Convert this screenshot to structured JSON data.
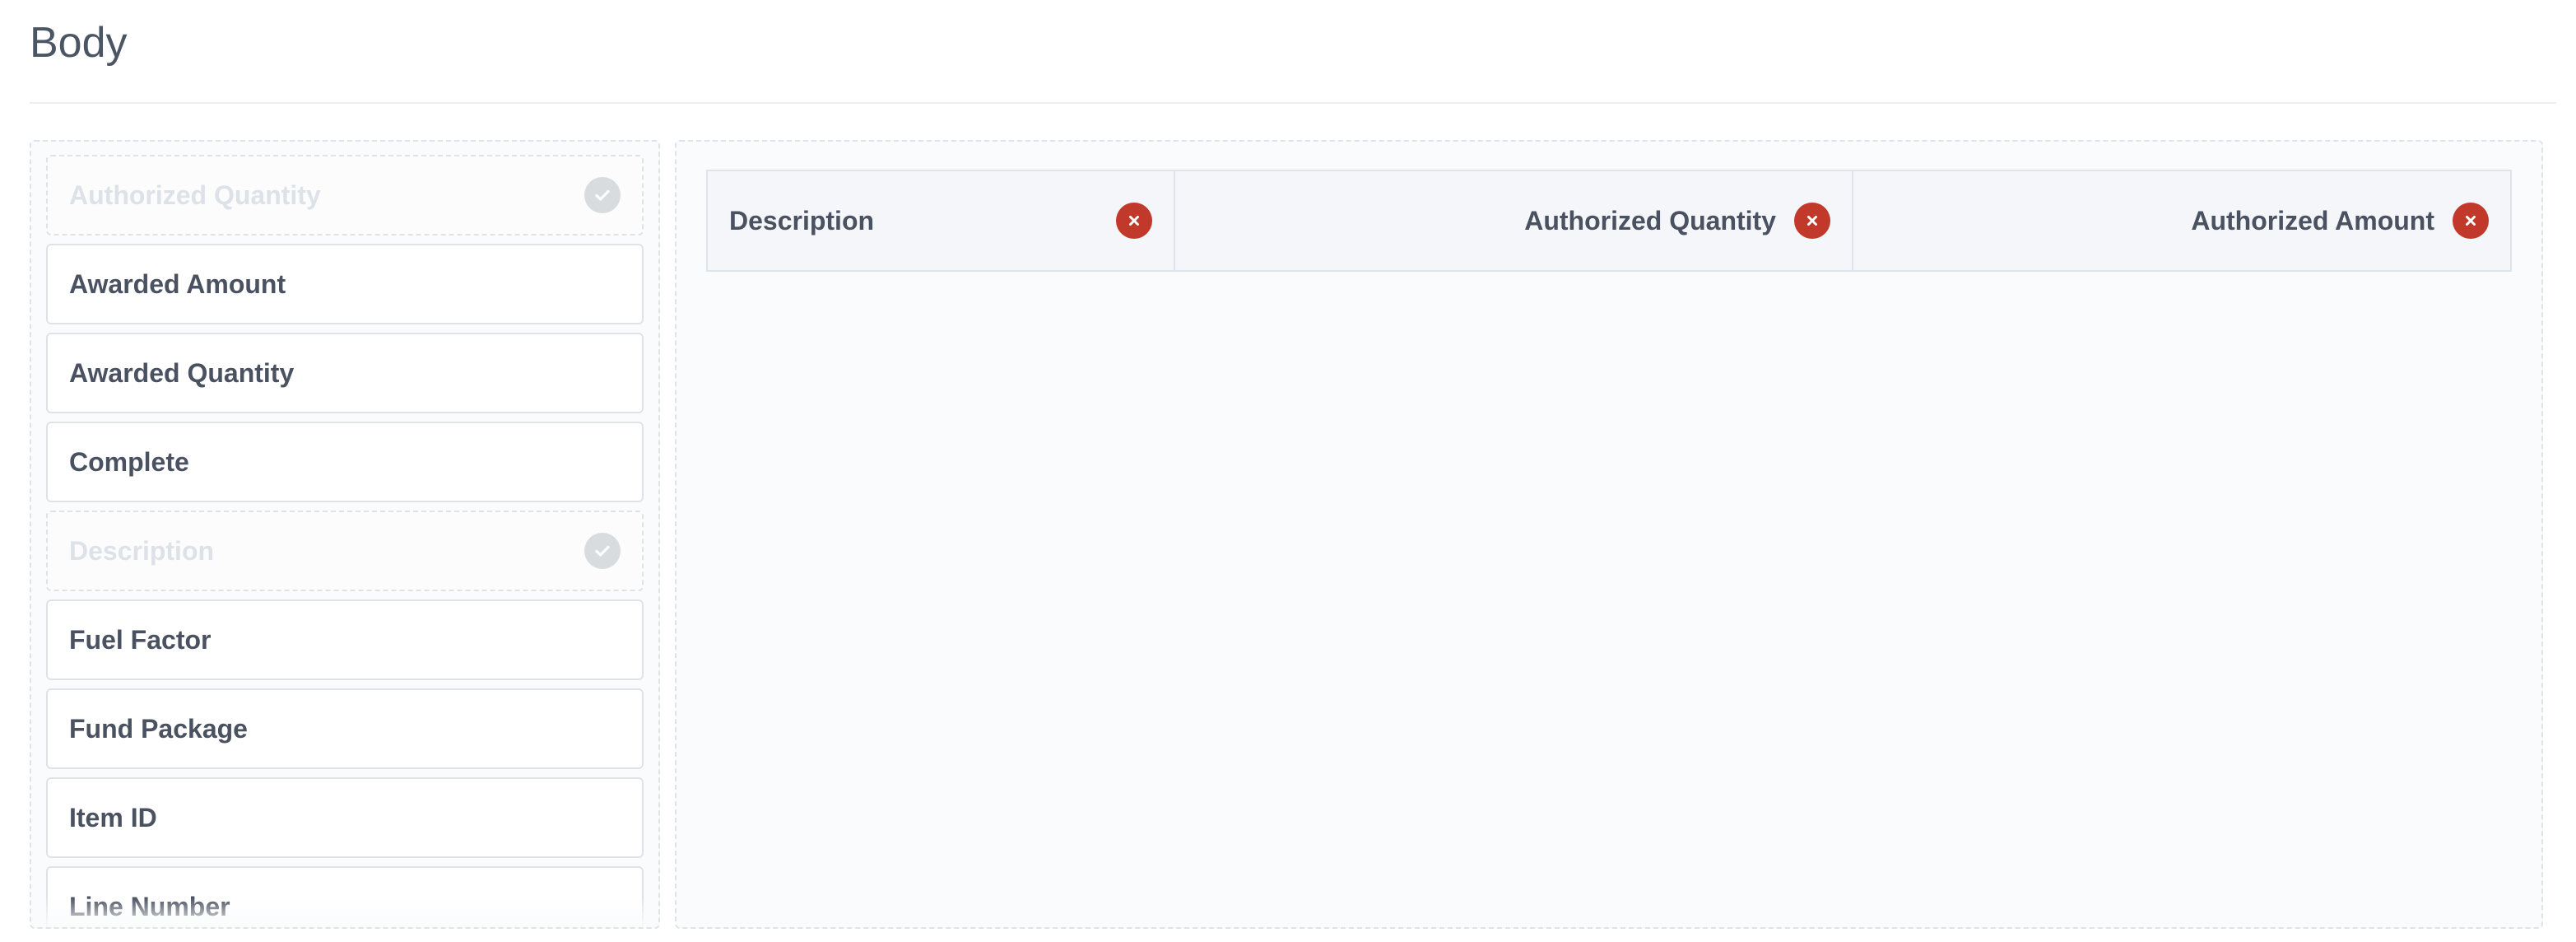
{
  "section": {
    "title": "Body"
  },
  "available_fields": [
    {
      "label": "Authorized Quantity",
      "used": true
    },
    {
      "label": "Awarded Amount",
      "used": false
    },
    {
      "label": "Awarded Quantity",
      "used": false
    },
    {
      "label": "Complete",
      "used": false
    },
    {
      "label": "Description",
      "used": true
    },
    {
      "label": "Fuel Factor",
      "used": false
    },
    {
      "label": "Fund Package",
      "used": false
    },
    {
      "label": "Item ID",
      "used": false
    },
    {
      "label": "Line Number",
      "used": false
    }
  ],
  "selected_columns": [
    {
      "label": "Description",
      "align": "left"
    },
    {
      "label": "Authorized Quantity",
      "align": "right"
    },
    {
      "label": "Authorized Amount",
      "align": "right"
    }
  ],
  "icons": {
    "used_indicator": "check-circle-icon",
    "remove_column": "close-circle-icon"
  },
  "colors": {
    "remove_red": "#c0392b",
    "check_gray": "#d9dcdf",
    "text_dark": "#4a5160",
    "text_muted": "#dde2e8"
  }
}
